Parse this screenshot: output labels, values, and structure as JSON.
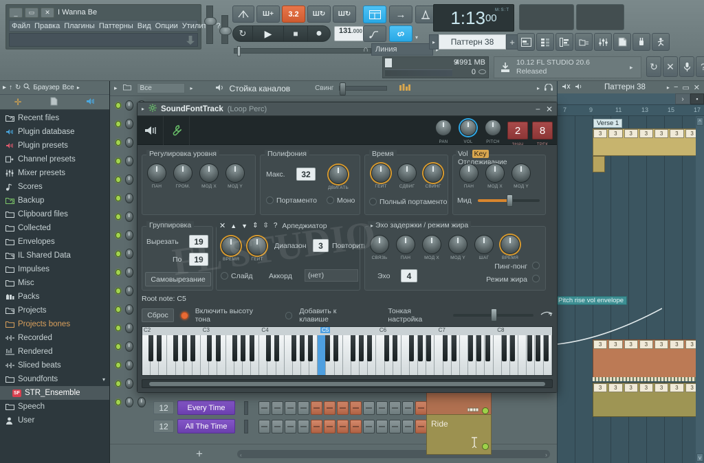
{
  "window": {
    "title": "I Wanna Be",
    "minimize": "_",
    "maximize": "▭",
    "close": "✕",
    "menu": [
      "Файл",
      "Правка",
      "Плагины",
      "Паттерны",
      "Вид",
      "Опции",
      "Утилиты",
      "?"
    ]
  },
  "transport": {
    "metronome_icon": "metronome-icon",
    "wait_icon": "wait-for-input-icon",
    "count_value": "3.2",
    "overlay_label": "Ш+",
    "loop_label": "Ш↻",
    "record_label": "Ш↻",
    "tempo_int": "131",
    "tempo_dec": ".000",
    "play": "▶",
    "stop": "■",
    "record": "●",
    "pattern_song": "↻"
  },
  "modebar": {
    "step_edit": "step-edit-icon",
    "arrow": "→",
    "typing_keyboard": "typing-keyboard-icon",
    "link_icon": "link-icon",
    "snap_label": "Линия",
    "snap_magnet": "magnet-icon"
  },
  "clock": {
    "main": "1:13",
    "sub": "00",
    "unit": "M:S:T"
  },
  "pattern": {
    "label": "Паттерн 38",
    "add": "+",
    "prev": "▸"
  },
  "toolbar_icons": [
    "playlist-icon",
    "channel-rack-icon",
    "piano-roll-icon",
    "browser-icon",
    "mixer-icon",
    "project-notes-icon",
    "plugin-picker-icon",
    "skip-icon"
  ],
  "status": {
    "cpu_value": "9",
    "mem_value": "4991 MB",
    "voices": "0",
    "version_line1": "10.12  FL STUDIO 20.6",
    "version_line2": "Released",
    "download_icon": "download-icon",
    "refresh": "↻",
    "shortcuts": "✕",
    "mic": "mic-icon",
    "help": "?"
  },
  "browser": {
    "header": {
      "arrow": "▸",
      "up": "↑",
      "back": "↻",
      "search": "search-icon",
      "title": "Браузер",
      "filter": "Все"
    },
    "items": [
      {
        "label": "Recent files",
        "icon": "folder-recent-icon",
        "color": "#cfd8da"
      },
      {
        "label": "Plugin database",
        "icon": "plugin-icon",
        "color": "#4aa8e0"
      },
      {
        "label": "Plugin presets",
        "icon": "plugin-preset-icon",
        "color": "#e05a6e"
      },
      {
        "label": "Channel presets",
        "icon": "channel-preset-icon",
        "color": "#cfd8da"
      },
      {
        "label": "Mixer presets",
        "icon": "mixer-preset-icon",
        "color": "#cfd8da"
      },
      {
        "label": "Scores",
        "icon": "score-icon",
        "color": "#cfd8da"
      },
      {
        "label": "Backup",
        "icon": "folder-backup-icon",
        "color": "#7fc96a"
      },
      {
        "label": "Clipboard files",
        "icon": "folder-icon",
        "color": "#cfd8da"
      },
      {
        "label": "Collected",
        "icon": "folder-icon",
        "color": "#cfd8da"
      },
      {
        "label": "Envelopes",
        "icon": "folder-icon",
        "color": "#cfd8da"
      },
      {
        "label": "IL Shared Data",
        "icon": "folder-link-icon",
        "color": "#cfd8da"
      },
      {
        "label": "Impulses",
        "icon": "folder-icon",
        "color": "#cfd8da"
      },
      {
        "label": "Misc",
        "icon": "folder-icon",
        "color": "#cfd8da"
      },
      {
        "label": "Packs",
        "icon": "packs-icon",
        "color": "#cfd8da"
      },
      {
        "label": "Projects",
        "icon": "folder-link-icon",
        "color": "#cfd8da"
      },
      {
        "label": "Projects bones",
        "icon": "folder-icon",
        "color": "#d9a05c"
      },
      {
        "label": "Recorded",
        "icon": "wave-icon",
        "color": "#cfd8da"
      },
      {
        "label": "Rendered",
        "icon": "render-icon",
        "color": "#cfd8da"
      },
      {
        "label": "Sliced beats",
        "icon": "wave-icon",
        "color": "#cfd8da"
      },
      {
        "label": "Soundfonts",
        "icon": "folder-icon",
        "color": "#cfd8da"
      },
      {
        "label": "STR_Ensemble",
        "icon": "sf-badge-icon",
        "color": "#e0515f",
        "selected": true
      },
      {
        "label": "Speech",
        "icon": "folder-icon",
        "color": "#cfd8da"
      },
      {
        "label": "User",
        "icon": "user-icon",
        "color": "#cfd8da"
      }
    ]
  },
  "rack": {
    "header": {
      "arrow": "▸",
      "filter": "Все",
      "filter_arrow": "▸",
      "title": "Стойка каналов",
      "swing_label": "Свинг",
      "graph_icon": "graph-editor-icon"
    },
    "channels": [
      {
        "name": "Every Time",
        "number": "12"
      },
      {
        "name": "All The Time",
        "number": "12"
      }
    ],
    "add_button": "+"
  },
  "playlist": {
    "title": "Паттерн 38",
    "minimize": "−",
    "maximize": "▭",
    "close": "✕",
    "menu_arrow": "▸",
    "bars": [
      "7",
      "9",
      "11",
      "13",
      "15",
      "17"
    ],
    "clips": [
      {
        "label": "Verse 1",
        "note": "3"
      },
      {
        "label": "Ride",
        "note": "3"
      },
      {
        "label": "Pitch rise vol envelope",
        "note": "3"
      }
    ],
    "note_glyph": "3"
  },
  "plugin": {
    "title": "SoundFontTrack",
    "subtitle": "(Loop Perc)",
    "expand_arrow": "▸",
    "gear_icon": "gear-icon",
    "minimize": "−",
    "close": "✕",
    "tool_icons": [
      "speaker-icon",
      "wrench-icon"
    ],
    "header_knobs": [
      {
        "label": "PAN",
        "name": "pan-knob"
      },
      {
        "label": "VOL",
        "name": "vol-knob"
      },
      {
        "label": "PITCH",
        "name": "pitch-knob"
      }
    ],
    "header_values": [
      {
        "label": "ЗНАЧ",
        "value": "2"
      },
      {
        "label": "ТРЕК",
        "value": "8"
      }
    ],
    "level": {
      "title": "Регулировка уровня",
      "knobs": [
        "ПАН",
        "ГРОМ.",
        "МОД X",
        "МОД Y"
      ]
    },
    "polyphony": {
      "title": "Полифония",
      "max_label": "Макс.",
      "max_value": "32",
      "slide_knob": "ДВИГАТЬ",
      "portamento": "Портаменто",
      "mono": "Моно"
    },
    "time": {
      "title": "Время",
      "knobs": [
        "ГЕЙТ",
        "СДВИГ",
        "СВИНГ"
      ],
      "full_portamento": "Полный портаменто"
    },
    "tracking": {
      "vol": "Vol",
      "key": "Key",
      "title": "Отслеживание",
      "knobs": [
        "ПАН",
        "МОД X",
        "МОД Y"
      ],
      "mid_label": "Мид"
    },
    "grouping": {
      "title": "Группировка",
      "cut_label": "Вырезать",
      "cut_value": "19",
      "by_label": "По",
      "by_value": "19",
      "selfcut": "Самовырезание"
    },
    "arp": {
      "title": "Арпеджиатор",
      "icons": [
        "✕",
        "▲",
        "▼",
        "⇕",
        "⇳",
        "?"
      ],
      "knobs": [
        "ВРЕМЯ",
        "ГЕЙТ"
      ],
      "range_label": "Диапазон",
      "range_value": "3",
      "repeat_label": "Повторить",
      "slide": "Слайд",
      "chord_label": "Аккорд",
      "chord_value": "(нет)"
    },
    "echo": {
      "title": "Эхо задержки / режим жира",
      "knobs": [
        "СВЯЗЬ",
        "ПАН",
        "МОД X",
        "МОД Y",
        "ШАГ",
        "ВРЕМЯ"
      ],
      "echo_label": "Эхо",
      "echo_value": "4",
      "pingpong": "Пинг-понг",
      "fatmode": "Режим жира"
    },
    "root": {
      "label": "Root note: C5",
      "reset": "Сброс",
      "enable_pitch": "Включить высоту тона",
      "add_to_key": "Добавить к клавише",
      "fine_tune": "Тонкая настройка"
    },
    "keyboard": {
      "octaves": [
        "C2",
        "C3",
        "C4",
        "C5",
        "C6",
        "C7",
        "C8"
      ],
      "highlighted": "C5"
    }
  },
  "watermark": "FL STUDIO"
}
